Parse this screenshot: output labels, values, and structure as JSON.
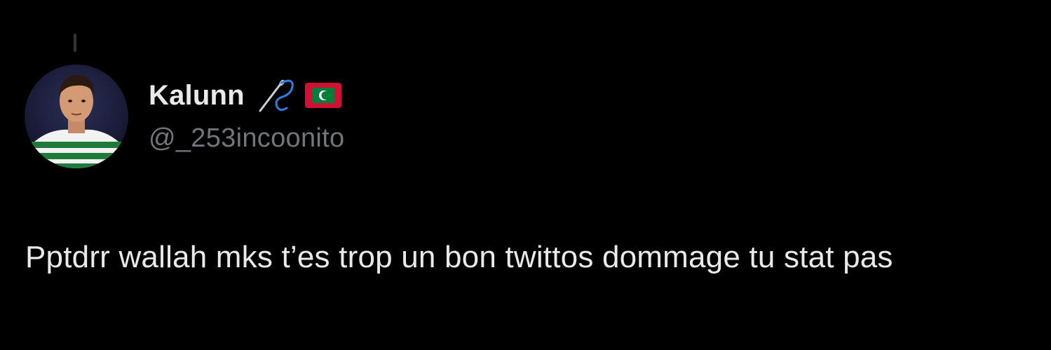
{
  "tweet": {
    "author": {
      "display_name": "Kalunn",
      "handle": "@_253incoonito",
      "avatar_icon": "profile-photo",
      "badges": [
        "sewing-needle-emoji",
        "maldives-flag-emoji"
      ]
    },
    "text": "Pptdrr wallah mks t’es trop un bon twittos dommage tu stat pas"
  },
  "colors": {
    "background": "#000000",
    "primary_text": "#e7e9ea",
    "secondary_text": "#71767b",
    "thread_line": "#333639"
  }
}
